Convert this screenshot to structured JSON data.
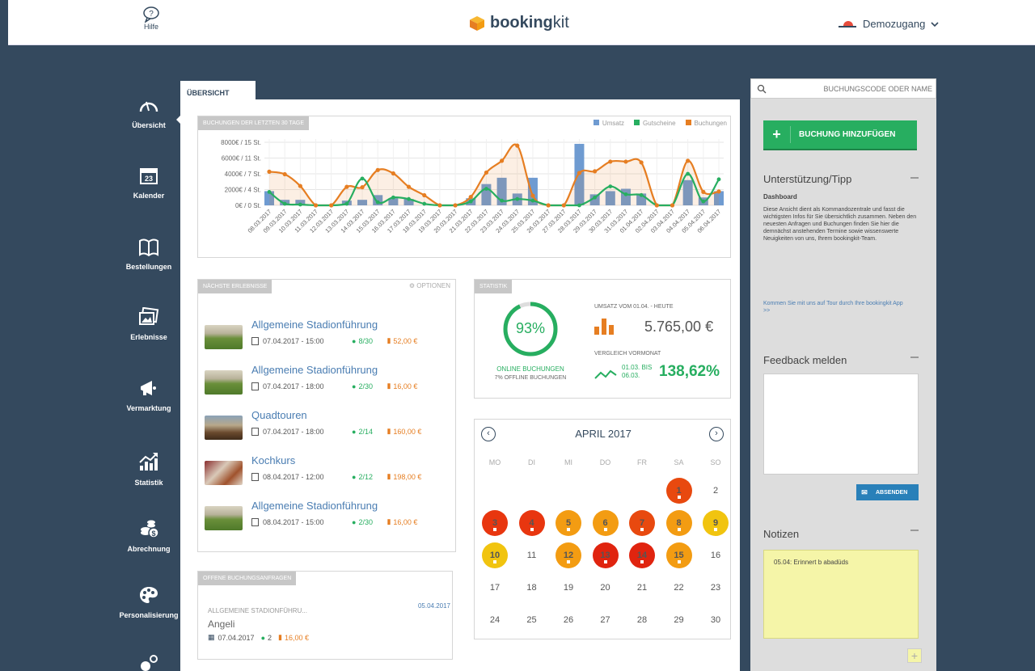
{
  "topbar": {
    "help_label": "Hilfe",
    "brand_bold": "booking",
    "brand_light": "kit",
    "user_name": "Demozugang"
  },
  "nav": [
    {
      "label": "Übersicht",
      "icon": "gauge-icon",
      "active": true
    },
    {
      "label": "Kalender",
      "icon": "calendar-icon"
    },
    {
      "label": "Bestellungen",
      "icon": "book-icon"
    },
    {
      "label": "Erlebnisse",
      "icon": "photos-icon"
    },
    {
      "label": "Vermarktung",
      "icon": "megaphone-icon"
    },
    {
      "label": "Statistik",
      "icon": "chart-icon"
    },
    {
      "label": "Abrechnung",
      "icon": "coins-icon"
    },
    {
      "label": "Personalisierung",
      "icon": "palette-icon"
    },
    {
      "label": "",
      "icon": "settings-icon"
    }
  ],
  "nav_calendar_day": "23",
  "tab_label": "ÜBERSICHT",
  "chart_panel": {
    "title": "BUCHUNGEN DER LETZTEN 30 TAGE",
    "legend": [
      {
        "name": "Umsatz",
        "color": "#6f9bd1"
      },
      {
        "name": "Gutscheine",
        "color": "#27ae60"
      },
      {
        "name": "Buchungen",
        "color": "#e67e22"
      }
    ]
  },
  "chart_data": {
    "type": "bar",
    "categories": [
      "08.03.2017",
      "09.03.2017",
      "10.03.2017",
      "11.03.2017",
      "12.03.2017",
      "13.03.2017",
      "14.03.2017",
      "15.03.2017",
      "16.03.2017",
      "17.03.2017",
      "18.03.2017",
      "19.03.2017",
      "20.03.2017",
      "21.03.2017",
      "22.03.2017",
      "23.03.2017",
      "24.03.2017",
      "25.03.2017",
      "26.03.2017",
      "27.03.2017",
      "28.03.2017",
      "29.03.2017",
      "30.03.2017",
      "31.03.2017",
      "01.04.2017",
      "02.04.2017",
      "03.04.2017",
      "04.04.2017",
      "05.04.2017",
      "06.04.2017"
    ],
    "ytick_labels": [
      "0€ / 0 St.",
      "2000€ / 4 St.",
      "4000€ / 7 St.",
      "6000€ / 11 St.",
      "8000€ / 15 St."
    ],
    "ylim": [
      0,
      8000
    ],
    "series": [
      {
        "name": "Umsatz",
        "kind": "bar",
        "values": [
          1800,
          700,
          700,
          0,
          0,
          600,
          700,
          1300,
          900,
          800,
          0,
          0,
          0,
          900,
          2700,
          3500,
          1500,
          3500,
          0,
          0,
          7800,
          1400,
          1800,
          2100,
          1500,
          0,
          0,
          3200,
          1000,
          1800
        ]
      },
      {
        "name": "Gutscheine",
        "kind": "line",
        "values": [
          1700,
          200,
          100,
          0,
          0,
          200,
          3400,
          400,
          1000,
          800,
          200,
          0,
          0,
          500,
          2100,
          600,
          800,
          600,
          0,
          0,
          0,
          1000,
          2400,
          1400,
          1300,
          0,
          0,
          4000,
          500,
          3300
        ]
      },
      {
        "name": "Buchungen",
        "kind": "line",
        "values": [
          8,
          7.4,
          4.6,
          0,
          0,
          4.4,
          4.3,
          8.4,
          7.6,
          4.4,
          2.4,
          0,
          0,
          2,
          7.8,
          10.6,
          14.2,
          2.3,
          0,
          0,
          7.7,
          8.1,
          10.4,
          10.4,
          10.2,
          0,
          0,
          10.6,
          3.2,
          3.3
        ]
      }
    ]
  },
  "events_panel": {
    "title": "NÄCHSTE ERLEBNISSE",
    "options_label": "OPTIONEN",
    "items": [
      {
        "title": "Allgemeine Stadionführung",
        "date": "07.04.2017 - 15:00",
        "count": "8/30",
        "price": "52,00 €",
        "thumb": "stadium"
      },
      {
        "title": "Allgemeine Stadionführung",
        "date": "07.04.2017 - 18:00",
        "count": "2/30",
        "price": "16,00 €",
        "thumb": "stadium"
      },
      {
        "title": "Quadtouren",
        "date": "07.04.2017 - 18:00",
        "count": "2/14",
        "price": "160,00 €",
        "thumb": "landscape"
      },
      {
        "title": "Kochkurs",
        "date": "08.04.2017 - 12:00",
        "count": "2/12",
        "price": "198,00 €",
        "thumb": "kitchen"
      },
      {
        "title": "Allgemeine Stadionführung",
        "date": "08.04.2017 - 15:00",
        "count": "2/30",
        "price": "16,00 €",
        "thumb": "stadium"
      }
    ]
  },
  "requests_panel": {
    "title": "OFFENE BUCHUNGSANFRAGEN",
    "item": {
      "event": "ALLGEMEINE STADIONFÜHRU...",
      "date": "05.04.2017",
      "name": "Angeli",
      "booking_date": "07.04.2017",
      "count": "2",
      "price": "16,00 €"
    }
  },
  "stats_panel": {
    "title": "STATISTIK",
    "online_percent": 93,
    "online_label": "93%",
    "online_caption": "ONLINE BUCHUNGEN",
    "offline_caption": "7% OFFLINE BUCHUNGEN",
    "revenue_label": "UMSATZ VOM 01.04. - HEUTE",
    "revenue_value": "5.765,00 €",
    "compare_label": "VERGLEICH VORMONAT",
    "compare_range1": "01.03. BIS",
    "compare_range2": "06.03.",
    "compare_value": "138,62%"
  },
  "calendar": {
    "month": "APRIL 2017",
    "weekdays": [
      "MO",
      "DI",
      "MI",
      "DO",
      "FR",
      "SA",
      "SO"
    ],
    "days": [
      {
        "d": "1",
        "col": 5,
        "row": 0,
        "color": "#e8490f"
      },
      {
        "d": "2",
        "col": 6,
        "row": 0
      },
      {
        "d": "3",
        "col": 0,
        "row": 1,
        "color": "#e8360f"
      },
      {
        "d": "4",
        "col": 1,
        "row": 1,
        "color": "#e8360f"
      },
      {
        "d": "5",
        "col": 2,
        "row": 1,
        "color": "#f39c12"
      },
      {
        "d": "6",
        "col": 3,
        "row": 1,
        "color": "#f39c12"
      },
      {
        "d": "7",
        "col": 4,
        "row": 1,
        "color": "#e8490f"
      },
      {
        "d": "8",
        "col": 5,
        "row": 1,
        "color": "#f39c12"
      },
      {
        "d": "9",
        "col": 6,
        "row": 1,
        "color": "#f1c40f"
      },
      {
        "d": "10",
        "col": 0,
        "row": 2,
        "color": "#f1c40f"
      },
      {
        "d": "11",
        "col": 1,
        "row": 2
      },
      {
        "d": "12",
        "col": 2,
        "row": 2,
        "color": "#f39c12"
      },
      {
        "d": "13",
        "col": 3,
        "row": 2,
        "color": "#e0240f"
      },
      {
        "d": "14",
        "col": 4,
        "row": 2,
        "color": "#e0240f"
      },
      {
        "d": "15",
        "col": 5,
        "row": 2,
        "color": "#f39c12"
      },
      {
        "d": "16",
        "col": 6,
        "row": 2
      },
      {
        "d": "17",
        "col": 0,
        "row": 3
      },
      {
        "d": "18",
        "col": 1,
        "row": 3
      },
      {
        "d": "19",
        "col": 2,
        "row": 3
      },
      {
        "d": "20",
        "col": 3,
        "row": 3
      },
      {
        "d": "21",
        "col": 4,
        "row": 3
      },
      {
        "d": "22",
        "col": 5,
        "row": 3
      },
      {
        "d": "23",
        "col": 6,
        "row": 3
      },
      {
        "d": "24",
        "col": 0,
        "row": 4
      },
      {
        "d": "25",
        "col": 1,
        "row": 4
      },
      {
        "d": "26",
        "col": 2,
        "row": 4
      },
      {
        "d": "27",
        "col": 3,
        "row": 4
      },
      {
        "d": "28",
        "col": 4,
        "row": 4
      },
      {
        "d": "29",
        "col": 5,
        "row": 4
      },
      {
        "d": "30",
        "col": 6,
        "row": 4
      }
    ]
  },
  "right": {
    "search_placeholder": "BUCHUNGSCODE ODER NAME",
    "add_button": "BUCHUNG HINZUFÜGEN",
    "support_title": "Unterstützung/Tipp",
    "support_subtitle": "Dashboard",
    "support_text": "Diese Ansicht dient als Kommandozentrale und fasst die wichtigsten Infos für Sie übersichtlich zusammen. Neben den neuesten Anfragen und Buchungen finden Sie hier die demnächst anstehenden Termine sowie wissenswerte Neuigkeiten von uns, Ihrem bookingkit-Team.",
    "tour_link": "Kommen Sie mit uns auf Tour durch Ihre bookingkit App >>",
    "feedback_title": "Feedback melden",
    "send_button": "ABSENDEN",
    "notes_title": "Notizen",
    "note_text": "05.04: Erinnert b abadüds"
  }
}
